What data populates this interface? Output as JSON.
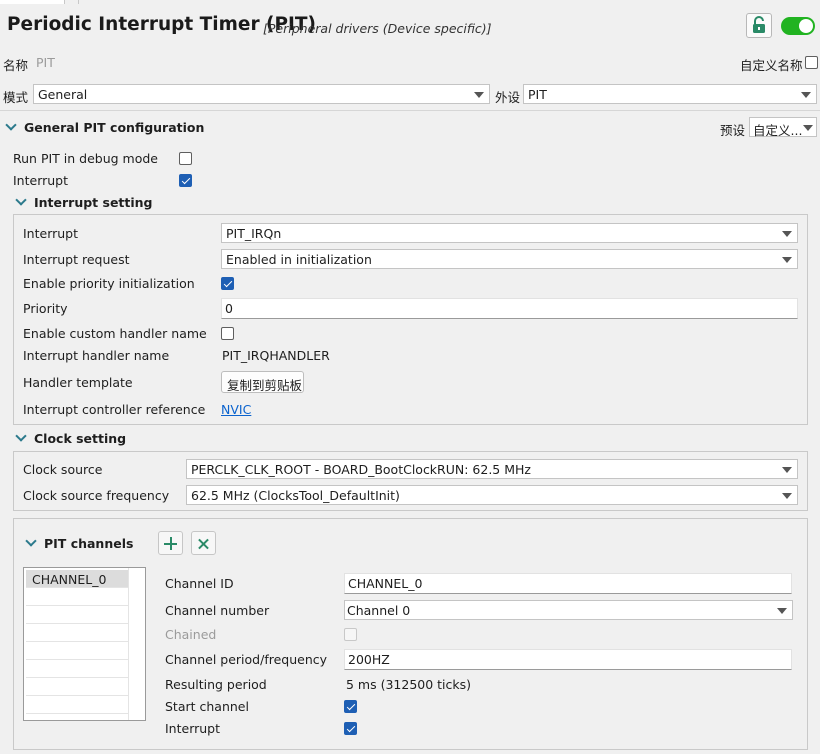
{
  "header": {
    "title": "Periodic Interrupt Timer (PIT)",
    "subtitle": "[Peripheral drivers (Device specific)]"
  },
  "name_row": {
    "label": "名称",
    "value": "PIT",
    "custom_name_label": "自定义名称",
    "custom_name_checked": false
  },
  "mode_row": {
    "mode_label": "模式",
    "mode_value": "General",
    "peripheral_label": "外设",
    "peripheral_value": "PIT"
  },
  "general_config": {
    "title": "General PIT configuration",
    "preset_label": "预设",
    "preset_value": "自定义...",
    "run_in_debug_label": "Run PIT in debug mode",
    "run_in_debug_checked": false,
    "interrupt_label": "Interrupt",
    "interrupt_checked": true
  },
  "interrupt_setting": {
    "title": "Interrupt setting",
    "interrupt_label": "Interrupt",
    "interrupt_value": "PIT_IRQn",
    "request_label": "Interrupt request",
    "request_value": "Enabled in initialization",
    "enable_priority_label": "Enable priority initialization",
    "enable_priority_checked": true,
    "priority_label": "Priority",
    "priority_value": "0",
    "custom_handler_label": "Enable custom handler name",
    "custom_handler_checked": false,
    "handler_name_label": "Interrupt handler name",
    "handler_name_value": "PIT_IRQHANDLER",
    "handler_template_label": "Handler template",
    "copy_button_label": "复制到剪贴板",
    "controller_ref_label": "Interrupt controller reference",
    "controller_ref_link": "NVIC"
  },
  "clock_setting": {
    "title": "Clock setting",
    "source_label": "Clock source",
    "source_value": "PERCLK_CLK_ROOT - BOARD_BootClockRUN: 62.5 MHz",
    "frequency_label": "Clock source frequency",
    "frequency_value": "62.5 MHz (ClocksTool_DefaultInit)"
  },
  "channels": {
    "title": "PIT channels",
    "add_icon": "plus-icon",
    "remove_icon": "close-icon",
    "list": [
      "CHANNEL_0"
    ],
    "channel_id_label": "Channel ID",
    "channel_id_value": "CHANNEL_0",
    "channel_number_label": "Channel number",
    "channel_number_value": "Channel 0",
    "chained_label": "Chained",
    "chained_checked": false,
    "period_label": "Channel period/frequency",
    "period_value": "200HZ",
    "resulting_label": "Resulting period",
    "resulting_value": "5 ms (312500 ticks)",
    "start_label": "Start channel",
    "start_checked": true,
    "interrupt_label": "Interrupt",
    "interrupt_checked": true
  },
  "colors": {
    "toggle_on": "#21b321",
    "lock_icon": "#2a8a67",
    "checkbox_checked": "#1e5fb4",
    "link": "#0b63ce",
    "section_chevron": "#2c7a8c"
  }
}
